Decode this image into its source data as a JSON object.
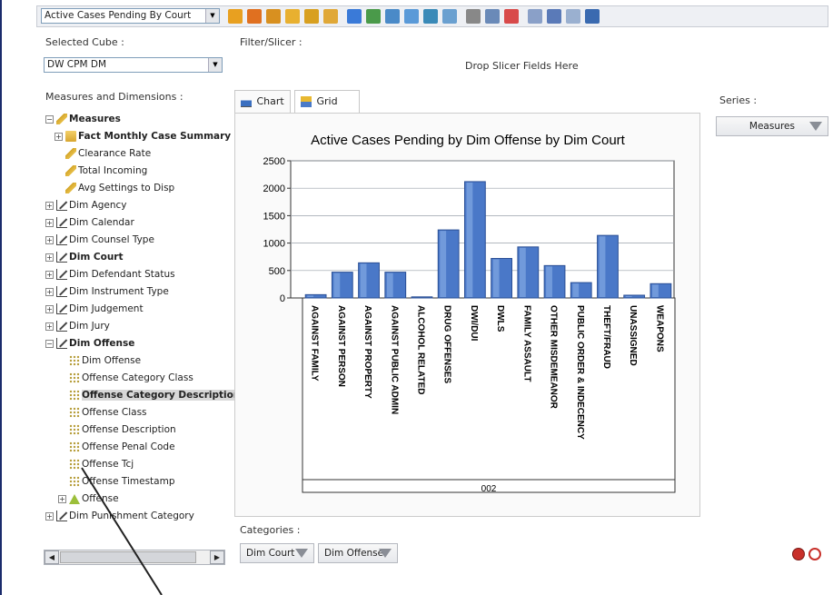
{
  "toolbar": {
    "report_select": "Active Cases Pending By Court"
  },
  "cube": {
    "label": "Selected Cube :",
    "value": "DW CPM DM"
  },
  "filter": {
    "label": "Filter/Slicer :",
    "drop_hint": "Drop Slicer Fields Here"
  },
  "tree": {
    "label": "Measures and Dimensions :",
    "items": [
      {
        "text": "Measures",
        "expander": "⊟",
        "icon": "measures-icon"
      },
      {
        "text": "Fact Monthly Case Summary",
        "expander": "⊞",
        "icon": "folder-icon"
      },
      {
        "text": "Clearance Rate",
        "icon": "measure-icon"
      },
      {
        "text": "Total Incoming",
        "icon": "measure-icon"
      },
      {
        "text": "Avg Settings to Disp",
        "icon": "measure-icon"
      },
      {
        "text": "Dim Agency",
        "expander": "⊞",
        "icon": "dimension-icon"
      },
      {
        "text": "Dim Calendar",
        "expander": "⊞",
        "icon": "dimension-icon"
      },
      {
        "text": "Dim Counsel Type",
        "expander": "⊞",
        "icon": "dimension-icon"
      },
      {
        "text": "Dim Court",
        "expander": "⊞",
        "icon": "dimension-icon"
      },
      {
        "text": "Dim Defendant Status",
        "expander": "⊞",
        "icon": "dimension-icon"
      },
      {
        "text": "Dim Instrument Type",
        "expander": "⊞",
        "icon": "dimension-icon"
      },
      {
        "text": "Dim Judgement",
        "expander": "⊞",
        "icon": "dimension-icon"
      },
      {
        "text": "Dim Jury",
        "expander": "⊞",
        "icon": "dimension-icon"
      },
      {
        "text": "Dim Offense",
        "expander": "⊟",
        "icon": "dimension-icon"
      },
      {
        "text": "Dim Offense",
        "icon": "attribute-icon"
      },
      {
        "text": "Offense Category Class",
        "icon": "attribute-icon"
      },
      {
        "text": "Offense Category Description",
        "icon": "attribute-icon"
      },
      {
        "text": "Offense Class",
        "icon": "attribute-icon"
      },
      {
        "text": "Offense Description",
        "icon": "attribute-icon"
      },
      {
        "text": "Offense Penal Code",
        "icon": "attribute-icon"
      },
      {
        "text": "Offense Tcj",
        "icon": "attribute-icon"
      },
      {
        "text": "Offense Timestamp",
        "icon": "attribute-icon"
      },
      {
        "text": "Offense",
        "expander": "⊞",
        "icon": "hierarchy-icon"
      },
      {
        "text": "Dim Punishment Category",
        "expander": "⊞",
        "icon": "dimension-icon"
      }
    ]
  },
  "tabs": {
    "chart": "Chart",
    "grid": "Grid"
  },
  "series": {
    "label": "Series :",
    "chip": "Measures"
  },
  "categories": {
    "label": "Categories :",
    "chips": [
      "Dim Court",
      "Dim Offense"
    ]
  },
  "colors": {
    "bar": "#4a78c8",
    "bar_dark": "#2a4f95",
    "border_accent": "#1a2b6b"
  },
  "chart_data": {
    "type": "bar",
    "title": "Active Cases Pending by Dim Offense by Dim Court",
    "categories": [
      "AGAINST FAMILY",
      "AGAINST PERSON",
      "AGAINST PROPERTY",
      "AGAINST PUBLIC ADMIN",
      "ALCOHOL RELATED",
      "DRUG OFFENSES",
      "DWI/DUI",
      "DWLS",
      "FAMILY ASSAULT",
      "OTHER MISDEMEANOR",
      "PUBLIC ORDER & INDECENCY",
      "THEFT/FRAUD",
      "UNASSIGNED",
      "WEAPONS"
    ],
    "group_label": "002",
    "values": [
      60,
      470,
      640,
      470,
      20,
      1240,
      2120,
      720,
      930,
      590,
      280,
      1140,
      50,
      260
    ],
    "yticks": [
      "2500",
      "2000",
      "1500",
      "1000",
      "500",
      "0"
    ],
    "ylim": [
      0,
      2500
    ],
    "grid": true
  }
}
